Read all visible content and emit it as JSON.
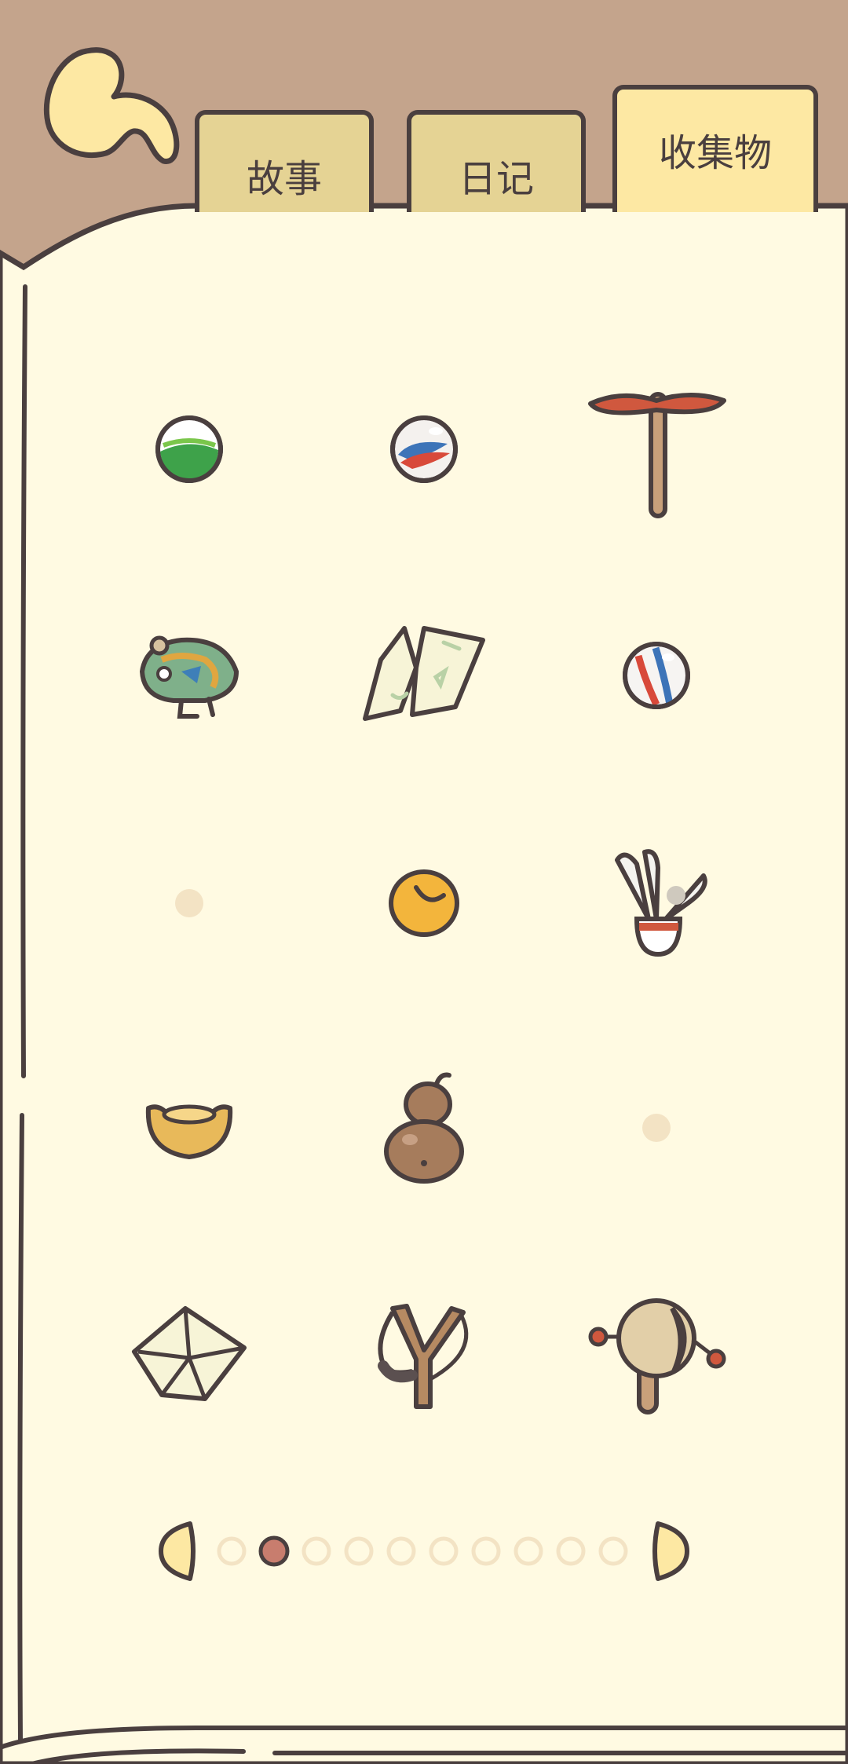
{
  "tabs": [
    {
      "key": "story",
      "label": "故事",
      "active": false
    },
    {
      "key": "diary",
      "label": "日记",
      "active": false
    },
    {
      "key": "collection",
      "label": "收集物",
      "active": true
    }
  ],
  "colors": {
    "background": "#c4a48c",
    "page": "#fffae2",
    "outline": "#4a3f3f",
    "tab_inactive": "#e5d394",
    "tab_active": "#fde8a3",
    "back_arrow": "#fde8a3",
    "pager_active": "#c87d6e",
    "pager_inactive": "#f3e3c4"
  },
  "grid": {
    "columns": 3,
    "items": [
      {
        "icon": "green-marble-icon",
        "collected": true
      },
      {
        "icon": "swirl-marble-icon",
        "collected": true
      },
      {
        "icon": "bamboo-dragonfly-icon",
        "collected": true
      },
      {
        "icon": "tin-frog-toy-icon",
        "collected": true
      },
      {
        "icon": "paper-fortune-teller-icon",
        "collected": true
      },
      {
        "icon": "striped-marble-icon",
        "collected": true
      },
      {
        "icon": "empty-slot-icon",
        "collected": false
      },
      {
        "icon": "yellow-bead-icon",
        "collected": true
      },
      {
        "icon": "shuttlecock-icon",
        "collected": true
      },
      {
        "icon": "gold-ingot-icon",
        "collected": true
      },
      {
        "icon": "gourd-icon",
        "collected": true
      },
      {
        "icon": "empty-slot-icon",
        "collected": false
      },
      {
        "icon": "paper-envelope-icon",
        "collected": true
      },
      {
        "icon": "slingshot-icon",
        "collected": true
      },
      {
        "icon": "rattle-drum-icon",
        "collected": true
      }
    ]
  },
  "pagination": {
    "total_pages": 10,
    "current_page": 2,
    "prev_icon": "prev-page-icon",
    "next_icon": "next-page-icon"
  },
  "back_button": {
    "icon": "back-arrow-icon"
  }
}
